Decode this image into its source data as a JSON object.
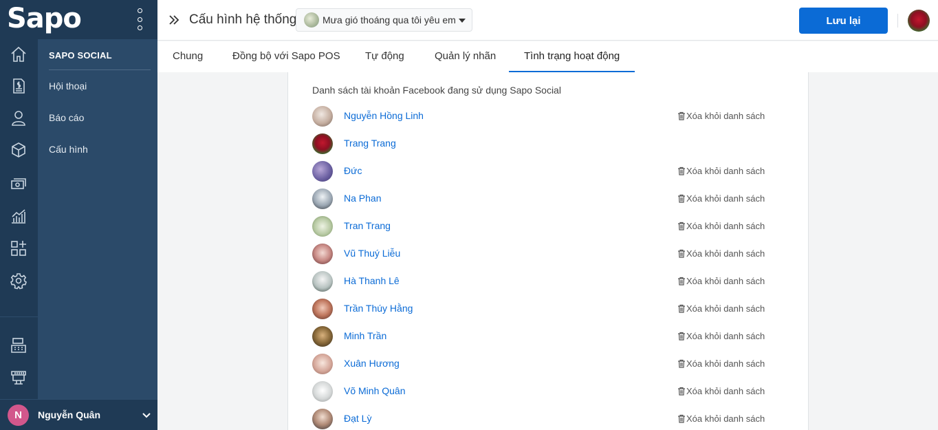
{
  "brand": {
    "logo_text": "Sapo"
  },
  "rail_icons": [
    "home-icon",
    "order-icon",
    "customer-icon",
    "product-icon",
    "cashbook-icon",
    "report-icon",
    "apps-icon",
    "settings-icon",
    "pos-icon",
    "store-icon"
  ],
  "submenu": {
    "heading": "SAPO SOCIAL",
    "items": [
      "Hội thoại",
      "Báo cáo",
      "Cấu hình"
    ]
  },
  "user": {
    "initial": "N",
    "name": "Nguyễn Quân"
  },
  "header": {
    "title": "Cấu hình hệ thống",
    "page_select": "Mưa gió thoáng qua tôi yêu em",
    "save_label": "Lưu lại"
  },
  "tabs": [
    "Chung",
    "Đồng bộ với Sapo POS",
    "Tự động",
    "Quản lý nhãn",
    "Tình trạng hoạt động"
  ],
  "active_tab": "Tình trạng hoạt động",
  "accounts": {
    "heading": "Danh sách tài khoản Facebook đang sử dụng Sapo Social",
    "remove_label": "Xóa khỏi danh sách",
    "list": [
      {
        "name": "Nguyễn Hồng Linh",
        "removable": true
      },
      {
        "name": "Trang Trang",
        "removable": false
      },
      {
        "name": "Đức",
        "removable": true
      },
      {
        "name": "Na Phan",
        "removable": true
      },
      {
        "name": "Tran Trang",
        "removable": true
      },
      {
        "name": "Vũ Thuý Liễu",
        "removable": true
      },
      {
        "name": "Hà Thanh Lê",
        "removable": true
      },
      {
        "name": "Trần Thúy Hằng",
        "removable": true
      },
      {
        "name": "Minh Trần",
        "removable": true
      },
      {
        "name": "Xuân Hương",
        "removable": true
      },
      {
        "name": "Võ Minh Quân",
        "removable": true
      },
      {
        "name": "Đạt Lỳ",
        "removable": true
      }
    ]
  },
  "colors": {
    "sidebar": "#1f3a55",
    "submenu": "#2b4a69",
    "accent": "#0b6bd6",
    "user_avatar": "#d2578c"
  }
}
